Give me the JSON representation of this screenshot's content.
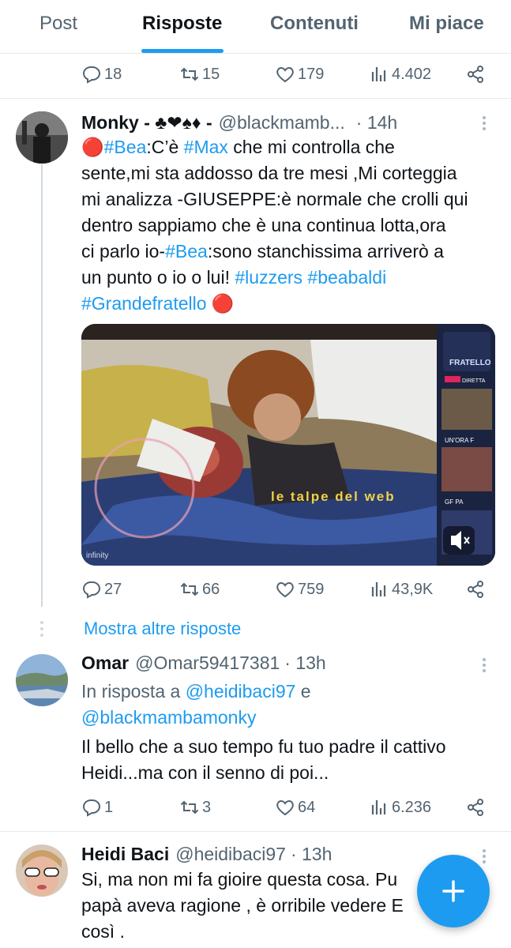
{
  "tabs": {
    "post": "Post",
    "risposte": "Risposte",
    "contenuti": "Contenuti",
    "mi_piace": "Mi piace"
  },
  "top_actions": {
    "replies": "18",
    "retweets": "15",
    "likes": "179",
    "views": "4.402"
  },
  "tweet1": {
    "name": "Monky - ♣❤♠♦ -",
    "handle": "@blackmamb...",
    "time": "· 14h",
    "line1_a": "🔴",
    "tag_bea": "#Bea",
    "line1_b": ":C’è ",
    "tag_max": "#Max",
    "line1_c": " che mi controlla che",
    "line2": "sente,mi sta addosso da tre mesi ,Mi corteggia",
    "line3": "mi analizza -GIUSEPPE:è normale che crolli qui",
    "line4": "dentro sappiamo che è una continua lotta,ora",
    "line5_a": "ci parlo io-",
    "line5_b": ":sono stanchissima arriverò a",
    "line6_a": "un punto o io o lui! ",
    "tag_luzzers": "#luzzers",
    "tag_beabaldi": "#beabaldi",
    "tag_gf": "#Grandefratello",
    "line7_b": " 🔴",
    "media": {
      "watermark_text": "le talpe del web",
      "side_brand": "FRATELLO",
      "side_live": "DIRETTA",
      "side_label1": "UN'ORA F",
      "side_label2": "GF PA",
      "channel_logo": "infinity"
    },
    "actions": {
      "replies": "27",
      "retweets": "66",
      "likes": "759",
      "views": "43,9K"
    }
  },
  "show_more": "Mostra altre risposte",
  "tweet2": {
    "name": "Omar",
    "handle": "@Omar59417381",
    "time": "· 13h",
    "reply_prefix": "In risposta a ",
    "reply_to1": "@heidibaci97",
    "reply_and": " e",
    "reply_to2": "@blackmambamonky",
    "line1": "Il bello che a suo tempo fu tuo padre il cattivo",
    "line2": "Heidi...ma con il senno di poi...",
    "actions": {
      "replies": "1",
      "retweets": "3",
      "likes": "64",
      "views": "6.236"
    }
  },
  "tweet3": {
    "name": "Heidi Baci",
    "handle": "@heidibaci97",
    "time": "· 13h",
    "line1": "Si, ma non mi fa gioire questa cosa. Pu",
    "line2": "papà aveva ragione , è orribile vedere E",
    "line3": "così ."
  },
  "colors": {
    "accent": "#1d9bf0",
    "muted": "#536471",
    "text": "#0f1419",
    "divider": "#e7e9ea"
  },
  "icons": [
    "reply-icon",
    "retweet-icon",
    "like-icon",
    "views-icon",
    "share-icon",
    "more-icon",
    "compose-plus-icon"
  ]
}
